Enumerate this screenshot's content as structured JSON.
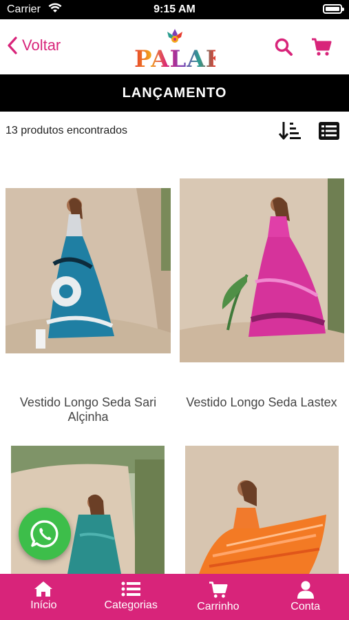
{
  "status_bar": {
    "carrier": "Carrier",
    "time": "9:15 AM"
  },
  "header": {
    "back_label": "Voltar",
    "logo_text": "PALAK"
  },
  "page_title": "LANÇAMENTO",
  "results": {
    "count_text": "13 produtos encontrados"
  },
  "products": [
    {
      "name": "Vestido Longo Seda Sari Alçinha"
    },
    {
      "name": "Vestido Longo Seda Lastex"
    },
    {
      "name": ""
    },
    {
      "name": ""
    }
  ],
  "bottom_nav": [
    {
      "label": "Início",
      "icon": "home-icon"
    },
    {
      "label": "Categorias",
      "icon": "list-icon"
    },
    {
      "label": "Carrinho",
      "icon": "cart-icon"
    },
    {
      "label": "Conta",
      "icon": "user-icon"
    }
  ],
  "colors": {
    "brand": "#d8247a",
    "black": "#000000",
    "whatsapp": "#3dbe4a"
  }
}
